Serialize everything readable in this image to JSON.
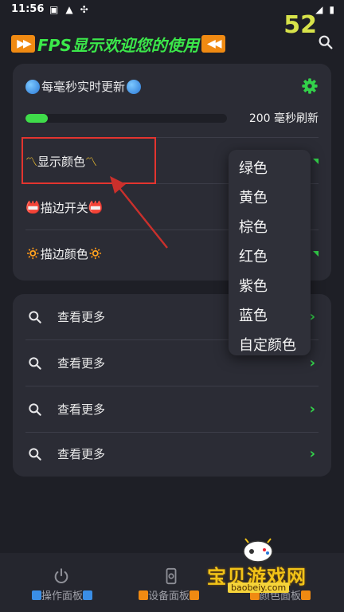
{
  "status_bar": {
    "time": "11:56",
    "fps_value": "52"
  },
  "header": {
    "title": "FPS显示欢迎您的使用",
    "left_badge": "⏩",
    "right_badge": "⏪"
  },
  "settings_card": {
    "update_title": "每毫秒实时更新",
    "refresh_label": "200 毫秒刷新",
    "progress_fraction": 0.11,
    "rows": [
      {
        "label": "显示颜色",
        "emoji": "〽"
      },
      {
        "label": "描边开关",
        "emoji": "📛"
      },
      {
        "label": "描边颜色",
        "emoji": "🔅"
      }
    ]
  },
  "more_card": {
    "items": [
      {
        "label": "查看更多"
      },
      {
        "label": "查看更多"
      },
      {
        "label": "查看更多"
      },
      {
        "label": "查看更多"
      }
    ]
  },
  "color_dropdown": {
    "options": [
      "绿色",
      "黄色",
      "棕色",
      "红色",
      "紫色",
      "蓝色",
      "自定颜色"
    ]
  },
  "bottom_nav": {
    "items": [
      {
        "label": "操作面板",
        "icon": "power-icon"
      },
      {
        "label": "设备面板",
        "icon": "phone-settings-icon"
      },
      {
        "label": "颜色面板",
        "icon": "palette-icon"
      }
    ]
  },
  "watermark": {
    "text": "宝贝游戏网",
    "url": "baobeiy.com"
  },
  "colors": {
    "accent": "#3fdc4a",
    "title_green": "#3be84a",
    "fps_yellow": "#d7e24a",
    "highlight_red": "#e3342f"
  }
}
